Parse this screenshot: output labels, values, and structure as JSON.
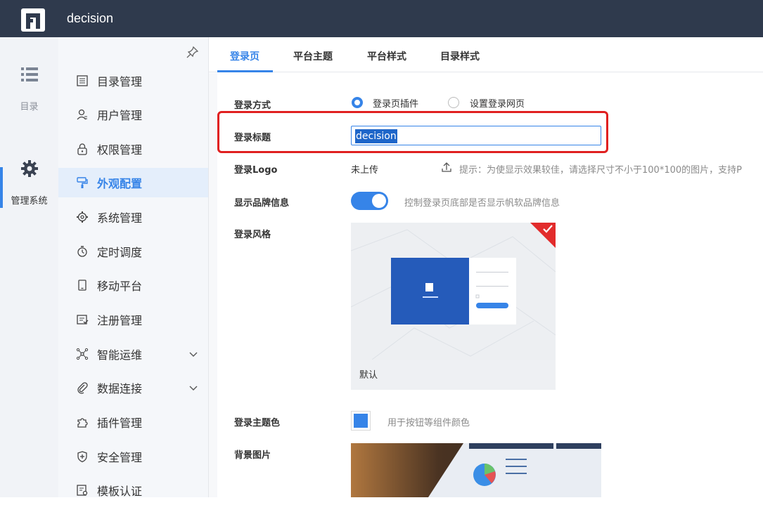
{
  "app": {
    "name": "decision"
  },
  "rail": {
    "items": [
      {
        "label": "目录",
        "icon": "list-icon"
      },
      {
        "label": "管理系统",
        "icon": "gear-icon"
      }
    ]
  },
  "nav": {
    "items": [
      {
        "label": "目录管理",
        "icon": "catalog-icon"
      },
      {
        "label": "用户管理",
        "icon": "user-icon"
      },
      {
        "label": "权限管理",
        "icon": "lock-icon"
      },
      {
        "label": "外观配置",
        "icon": "brush-icon",
        "active": true
      },
      {
        "label": "系统管理",
        "icon": "gear-icon"
      },
      {
        "label": "定时调度",
        "icon": "timer-icon"
      },
      {
        "label": "移动平台",
        "icon": "mobile-icon"
      },
      {
        "label": "注册管理",
        "icon": "register-icon"
      },
      {
        "label": "智能运维",
        "icon": "network-icon",
        "expandable": true
      },
      {
        "label": "数据连接",
        "icon": "paperclip-icon",
        "expandable": true
      },
      {
        "label": "插件管理",
        "icon": "puzzle-icon"
      },
      {
        "label": "安全管理",
        "icon": "shield-icon"
      },
      {
        "label": "模板认证",
        "icon": "certificate-icon"
      }
    ]
  },
  "tabs": [
    {
      "label": "登录页",
      "active": true
    },
    {
      "label": "平台主题"
    },
    {
      "label": "平台样式"
    },
    {
      "label": "目录样式"
    }
  ],
  "form": {
    "login_method": {
      "label": "登录方式",
      "options": [
        "登录页插件",
        "设置登录网页"
      ],
      "selected": "登录页插件"
    },
    "login_title": {
      "label": "登录标题",
      "value": "decision"
    },
    "login_logo": {
      "label": "登录Logo",
      "status": "未上传",
      "hint": "提示：为使显示效果较佳，请选择尺寸不小于100*100的图片，支持P"
    },
    "brand_info": {
      "label": "显示品牌信息",
      "enabled": true,
      "hint": "控制登录页底部是否显示帆软品牌信息"
    },
    "login_style": {
      "label": "登录风格",
      "selected_style": "默认"
    },
    "theme_color": {
      "label": "登录主题色",
      "value": "#3684e8",
      "hint": "用于按钮等组件颜色"
    },
    "background": {
      "label": "背景图片"
    }
  },
  "colors": {
    "accent": "#3684e8",
    "topbar": "#2f3a4d",
    "highlight": "#e02020"
  }
}
